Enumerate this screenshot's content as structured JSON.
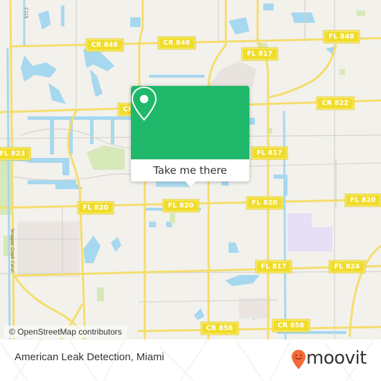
{
  "map": {
    "road_labels": [
      {
        "id": "cr848-a",
        "text": "CR 848"
      },
      {
        "id": "cr848-b",
        "text": "CR 848"
      },
      {
        "id": "fl848",
        "text": "FL 848"
      },
      {
        "id": "fl817-a",
        "text": "FL 817"
      },
      {
        "id": "cr822-partial",
        "text": "CR"
      },
      {
        "id": "cr822-b",
        "text": "CR 822"
      },
      {
        "id": "fl823",
        "text": "FL 823"
      },
      {
        "id": "fl817-b",
        "text": "FL 817"
      },
      {
        "id": "fl820-a",
        "text": "FL 820"
      },
      {
        "id": "fl820-b",
        "text": "FL 820"
      },
      {
        "id": "fl820-c",
        "text": "FL 820"
      },
      {
        "id": "fl820-d",
        "text": "FL 820"
      },
      {
        "id": "fl817-c",
        "text": "FL 817"
      },
      {
        "id": "fl824",
        "text": "FL 824"
      },
      {
        "id": "cr858-a",
        "text": "CR 858"
      },
      {
        "id": "cr858-b",
        "text": "CR 858"
      }
    ],
    "canal_labels": [
      "C115",
      "C-115",
      "Snapper Creek Canal"
    ],
    "attribution": "© OpenStreetMap contributors",
    "colors": {
      "land": "#f2f1ec",
      "road": "#f5dd6b",
      "water": "#a6d8ef",
      "park": "#d7e8b9",
      "popup": "#20b86a"
    }
  },
  "popup": {
    "icon": "location-pin-icon",
    "button_label": "Take me there"
  },
  "footer": {
    "place_name": "American Leak Detection, Miami",
    "brand": "moovit",
    "brand_color": "#f26b38"
  }
}
